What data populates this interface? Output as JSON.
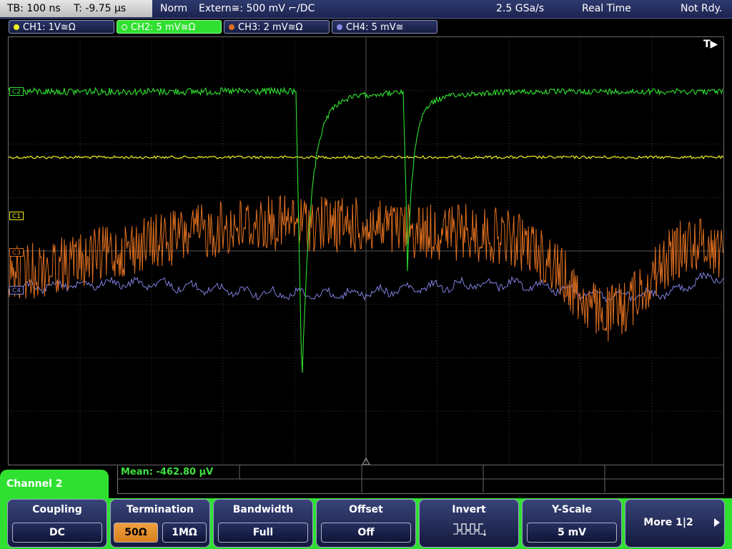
{
  "status_bar": {
    "timebase": "TB: 100 ns",
    "trigger_time": "T: -9.75 µs",
    "trigger_mode": "Norm",
    "trigger_source": "Extern≅: 500 mV ⌐/DC",
    "sample_rate": "2.5 GSa/s",
    "acq_mode": "Real Time",
    "status": "Not Rdy."
  },
  "channels": [
    {
      "label": "CH1: 1V≅Ω",
      "color": "#f0f020",
      "active": false
    },
    {
      "label": "CH2: 5 mV≅Ω",
      "color": "#30e030",
      "active": true
    },
    {
      "label": "CH3: 2 mV≅Ω",
      "color": "#e07020",
      "active": false
    },
    {
      "label": "CH4: 5 mV≅",
      "color": "#8888e8",
      "active": false
    }
  ],
  "screen": {
    "trigger_marker": "T▶",
    "markers": [
      "C2",
      "C1",
      "C3",
      "C4"
    ]
  },
  "measurement": {
    "mean": "Mean: -462.80 µV"
  },
  "menu": {
    "channel_title": "Channel 2",
    "coupling": {
      "title": "Coupling",
      "value": "DC"
    },
    "termination": {
      "title": "Termination",
      "opt1": "50Ω",
      "opt2": "1MΩ"
    },
    "bandwidth": {
      "title": "Bandwidth",
      "value": "Full"
    },
    "offset": {
      "title": "Offset",
      "value": "Off"
    },
    "invert": {
      "title": "Invert"
    },
    "yscale": {
      "title": "Y-Scale",
      "value": "5 mV"
    },
    "more": {
      "label": "More 1|2"
    }
  }
}
